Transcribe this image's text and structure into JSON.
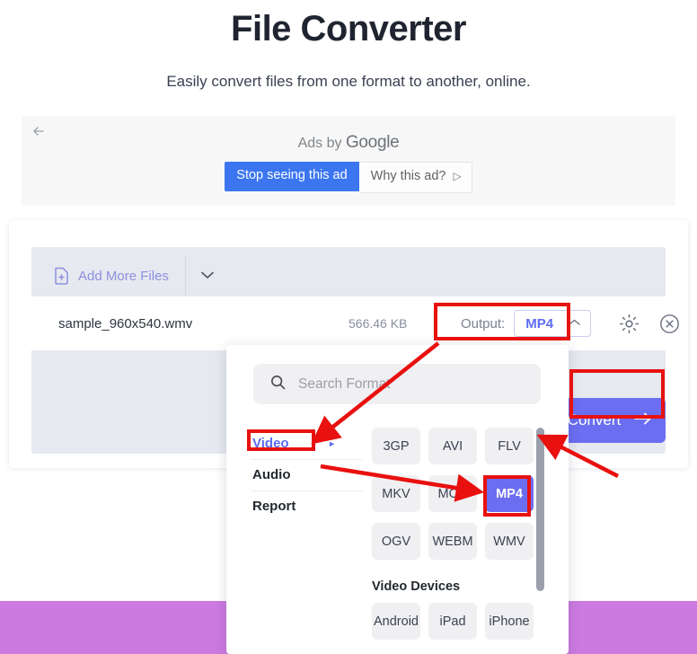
{
  "header": {
    "title": "File Converter",
    "subtitle": "Easily convert files from one format to another, online."
  },
  "ad": {
    "back_icon": "back-arrow-icon",
    "by_label": "Ads by ",
    "by_brand": "Google",
    "stop_label": "Stop seeing this ad",
    "why_label": "Why this ad?",
    "why_glyph": "▷"
  },
  "toolbar": {
    "add_more_label": "Add More Files",
    "add_more_icon": "file-add-icon",
    "caret_icon": "chevron-down-icon"
  },
  "file_row": {
    "name": "sample_960x540.wmv",
    "size": "566.46 KB",
    "output_label": "Output:",
    "output_value": "MP4",
    "output_caret": "chevron-up-icon",
    "settings_icon": "gear-icon",
    "remove_icon": "close-circle-icon"
  },
  "convert": {
    "label": "Convert",
    "arrow": "→"
  },
  "dropdown": {
    "search_placeholder": "Search Format",
    "search_value": "",
    "search_icon": "search-icon",
    "categories": [
      {
        "label": "Video",
        "active": true,
        "caret": "►"
      },
      {
        "label": "Audio",
        "active": false,
        "caret": ""
      },
      {
        "label": "Report",
        "active": false,
        "caret": ""
      }
    ],
    "formats": [
      {
        "label": "3GP",
        "selected": false
      },
      {
        "label": "AVI",
        "selected": false
      },
      {
        "label": "FLV",
        "selected": false
      },
      {
        "label": "MKV",
        "selected": false
      },
      {
        "label": "MOV",
        "selected": false
      },
      {
        "label": "MP4",
        "selected": true
      },
      {
        "label": "OGV",
        "selected": false
      },
      {
        "label": "WEBM",
        "selected": false
      },
      {
        "label": "WMV",
        "selected": false
      }
    ],
    "devices_title": "Video Devices",
    "devices": [
      {
        "label": "Android",
        "selected": false
      },
      {
        "label": "iPad",
        "selected": false
      },
      {
        "label": "iPhone",
        "selected": false
      }
    ]
  },
  "colors": {
    "accent": "#6b6ef0",
    "accent_light": "#8c8fe0",
    "ad_blue": "#3b76f0",
    "annotation_red": "#e8110f",
    "band_purple": "#cc7ae0",
    "panel_grey": "#e6e9ef"
  }
}
